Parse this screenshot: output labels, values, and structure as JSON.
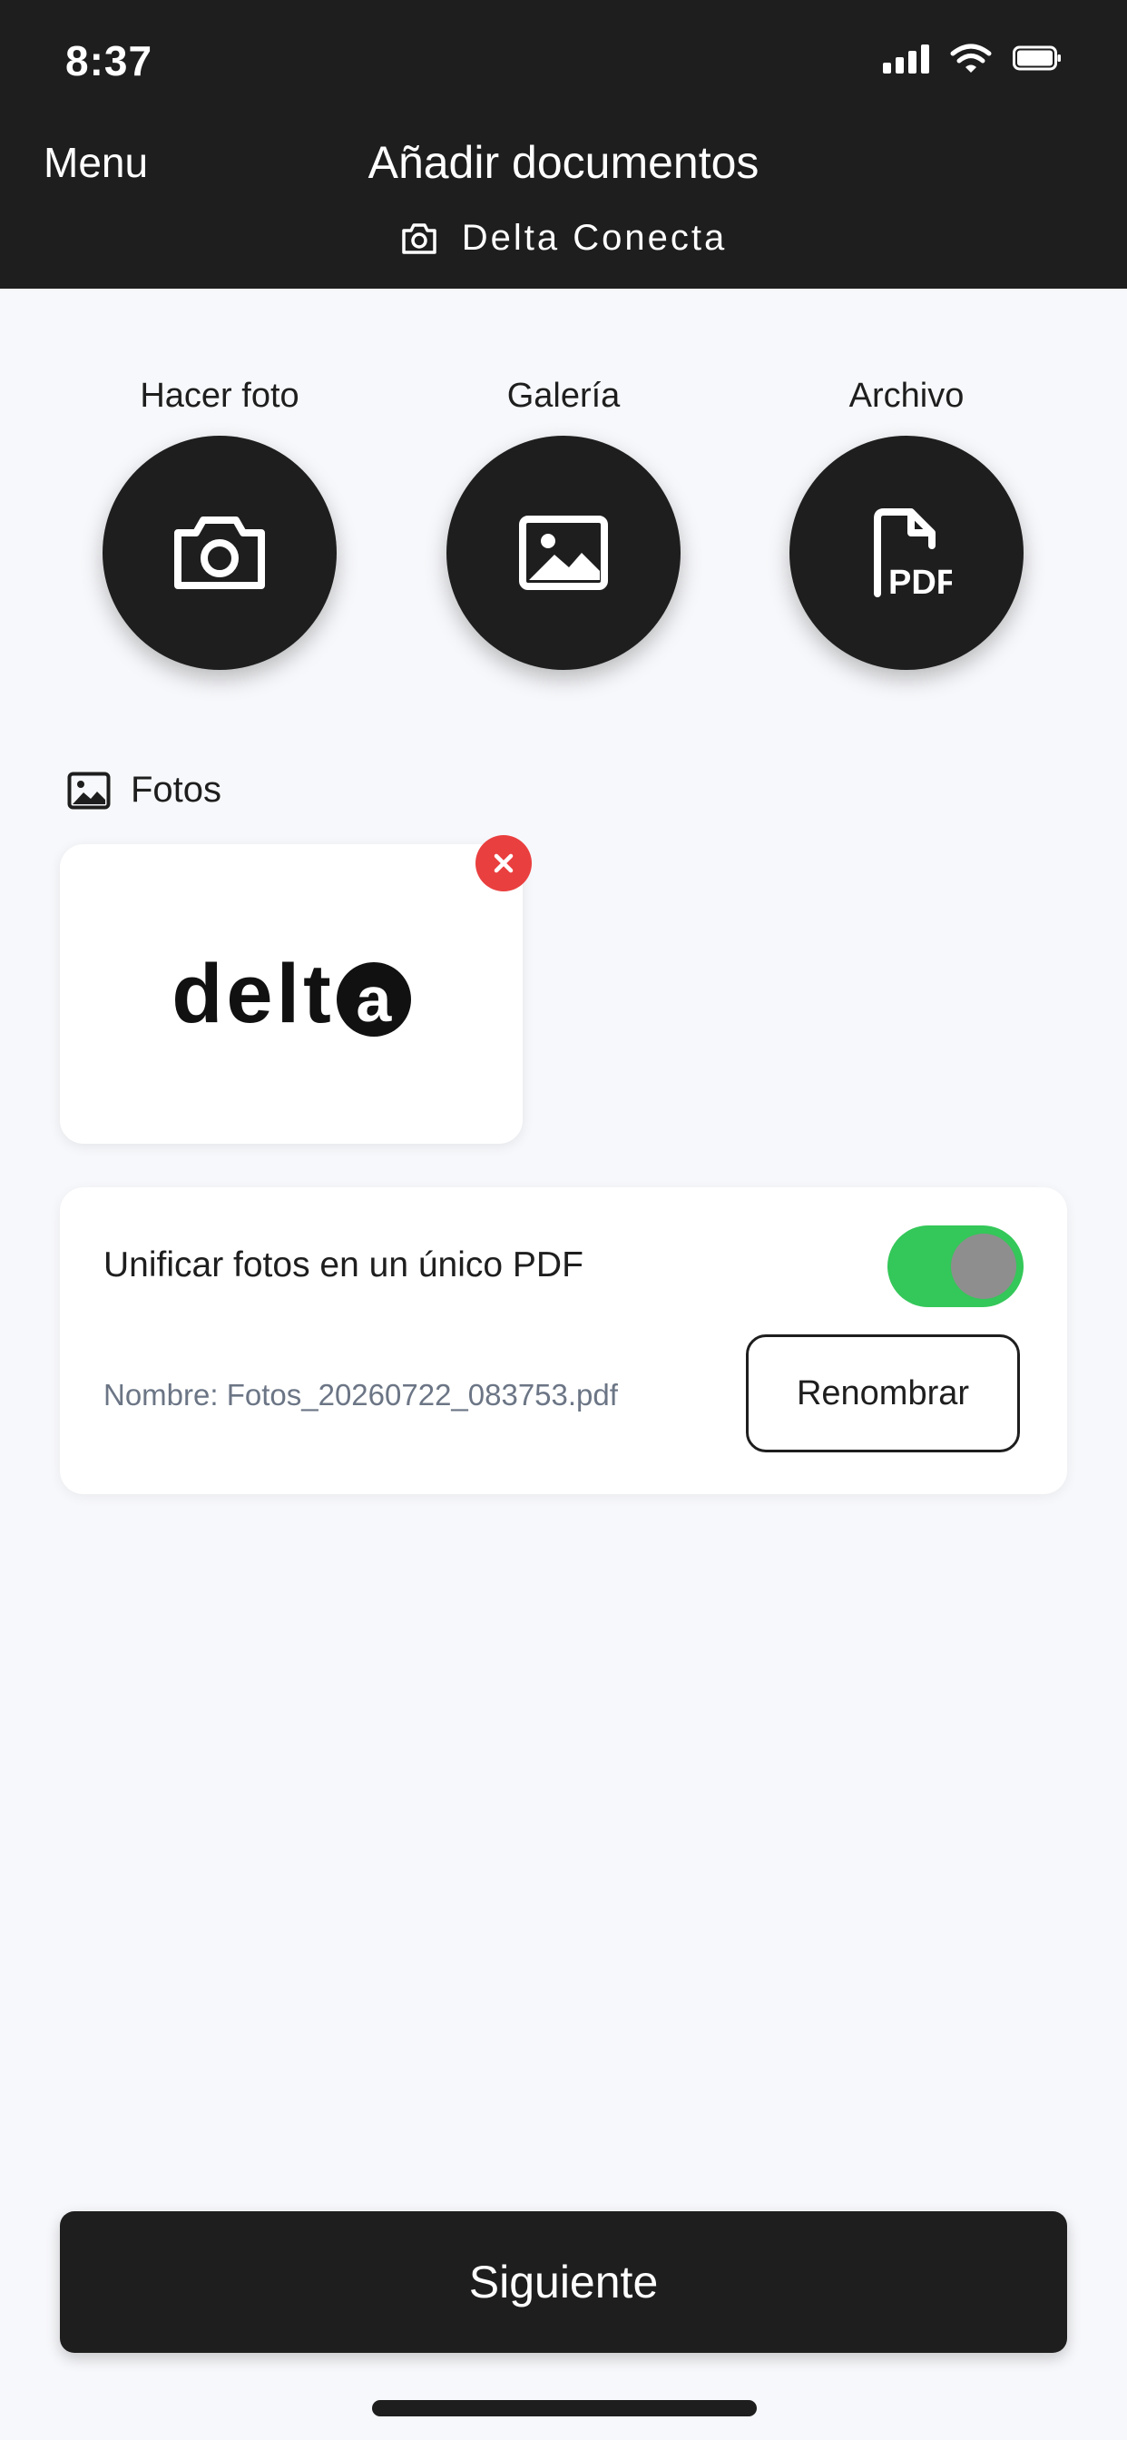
{
  "status_bar": {
    "time": "8:37"
  },
  "header": {
    "menu_label": "Menu",
    "title": "Añadir documentos",
    "subtitle": "Delta Conecta"
  },
  "actions": [
    {
      "label": "Hacer foto",
      "icon": "camera-icon"
    },
    {
      "label": "Galería",
      "icon": "image-icon"
    },
    {
      "label": "Archivo",
      "icon": "pdf-file-icon"
    }
  ],
  "photos_section": {
    "title": "Fotos",
    "items": [
      {
        "logo_text": "delt",
        "logo_circle_letter": "a"
      }
    ]
  },
  "unify": {
    "label": "Unificar fotos en un único PDF",
    "enabled": true,
    "filename": "Nombre: Fotos_20260722_083753.pdf",
    "rename_label": "Renombrar"
  },
  "footer": {
    "next_label": "Siguiente"
  },
  "colors": {
    "dark": "#1e1e1e",
    "background": "#f7f8fb",
    "toggle_on": "#34c759",
    "remove_red": "#ea3f3f"
  }
}
